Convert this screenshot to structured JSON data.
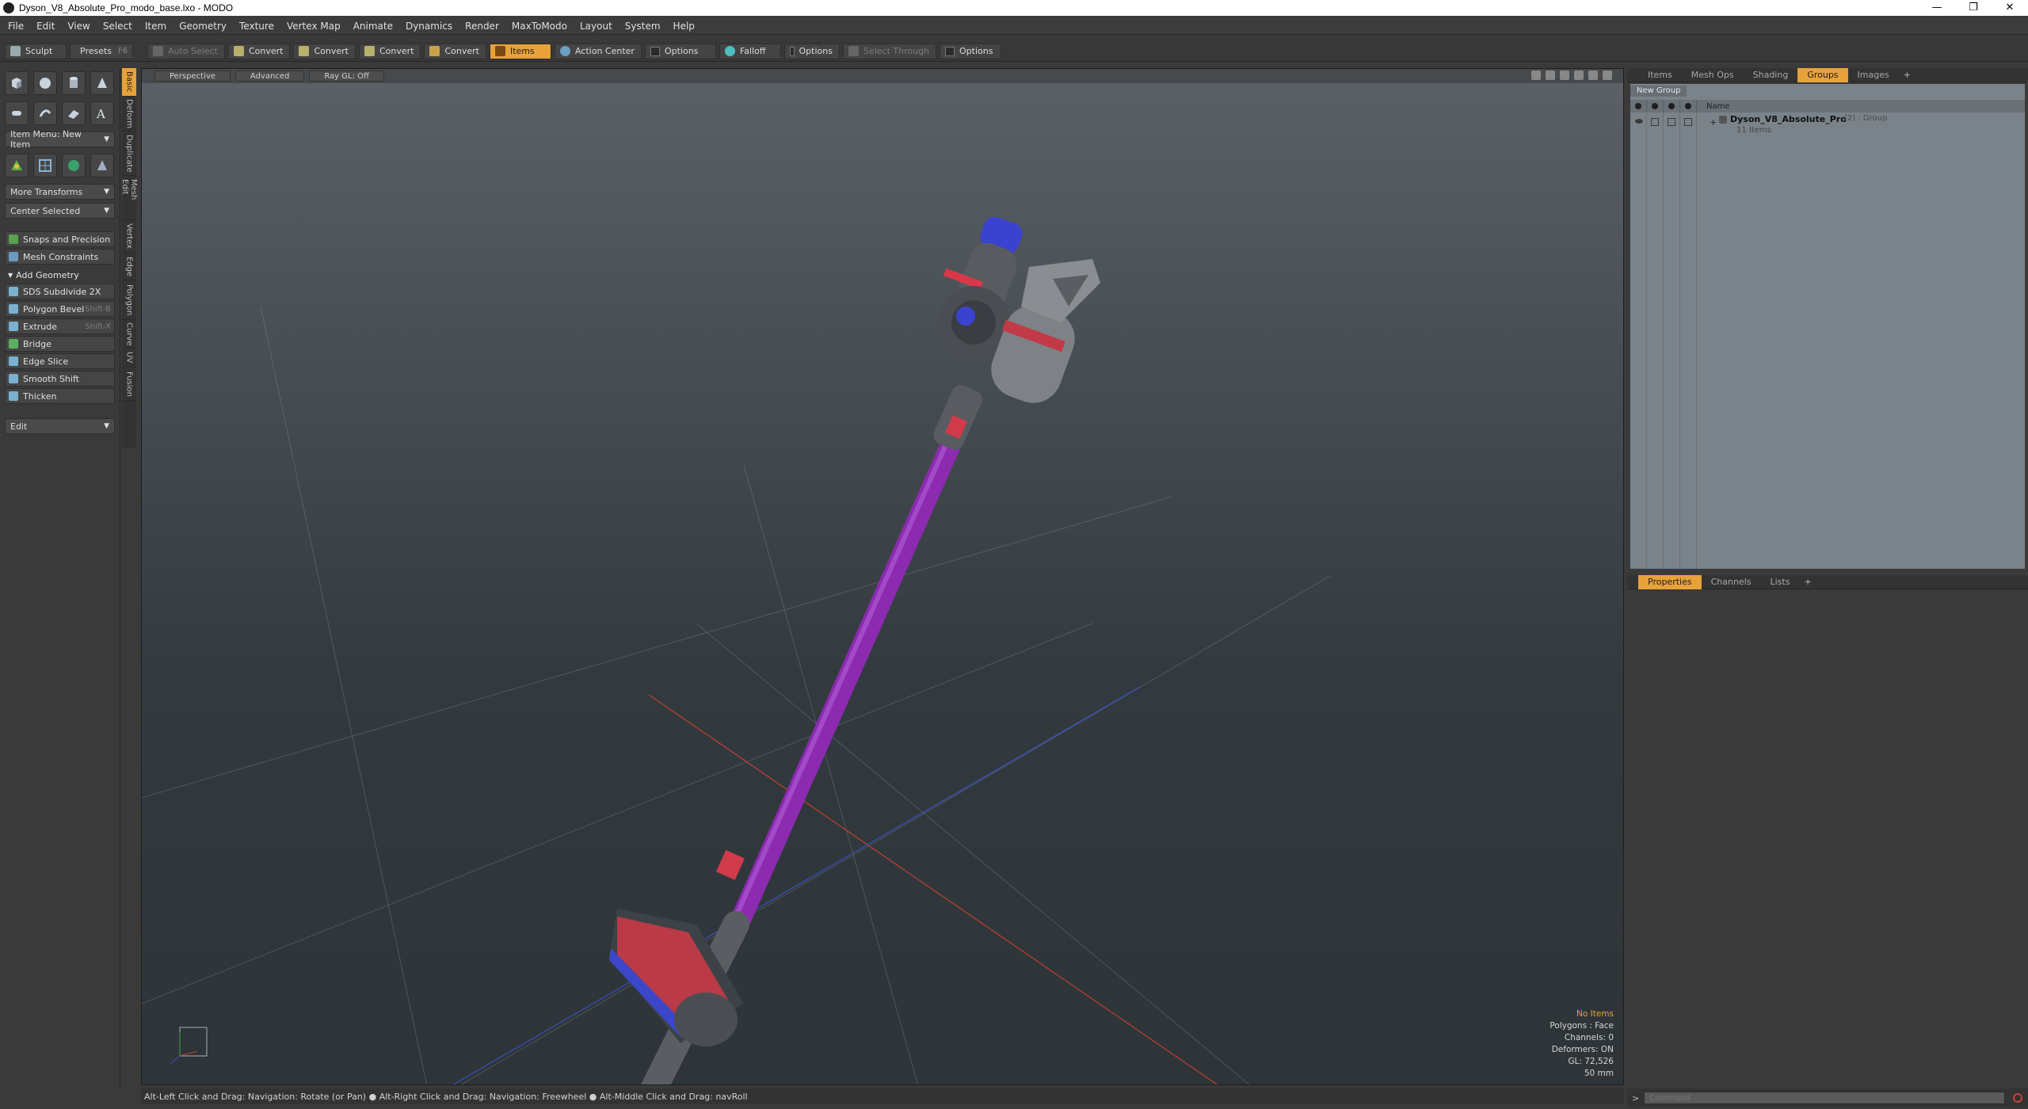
{
  "window": {
    "title": "Dyson_V8_Absolute_Pro_modo_base.lxo - MODO",
    "controls": [
      "—",
      "❐",
      "✕"
    ]
  },
  "menubar": [
    "File",
    "Edit",
    "View",
    "Select",
    "Item",
    "Geometry",
    "Texture",
    "Vertex Map",
    "Animate",
    "Dynamics",
    "Render",
    "MaxToModo",
    "Layout",
    "System",
    "Help"
  ],
  "toolbar": {
    "sculpt": "Sculpt",
    "presets": "Presets",
    "presets_shortcut": "F6",
    "auto_select": "Auto Select",
    "convert1": "Convert",
    "convert2": "Convert",
    "convert3": "Convert",
    "convert4": "Convert",
    "items": "Items",
    "action_center": "Action Center",
    "options1": "Options",
    "falloff": "Falloff",
    "options2": "Options",
    "select_through": "Select Through",
    "options3": "Options"
  },
  "leftpanel": {
    "item_menu": "Item Menu: New Item",
    "more_transforms": "More Transforms",
    "center_selected": "Center Selected",
    "snaps": "Snaps and Precision",
    "mesh_constraints": "Mesh Constraints",
    "add_geometry": "Add Geometry",
    "sds": "SDS Subdivide 2X",
    "polygon_bevel": "Polygon Bevel",
    "polygon_bevel_sc": "Shift-B",
    "extrude": "Extrude",
    "extrude_sc": "Shift-X",
    "bridge": "Bridge",
    "edge_slice": "Edge Slice",
    "smooth_shift": "Smooth Shift",
    "thicken": "Thicken",
    "edit": "Edit"
  },
  "vtabs": [
    "Basic",
    "Deform",
    "Duplicate",
    "Mesh Edit",
    "Vertex",
    "Edge",
    "Polygon",
    "Curve",
    "UV",
    "Fusion"
  ],
  "viewport": {
    "tabs": [
      "Perspective",
      "Advanced",
      "Ray GL: Off"
    ],
    "info": {
      "selection": "No Items",
      "polygons": "Polygons : Face",
      "channels": "Channels: 0",
      "deformers": "Deformers: ON",
      "gl": "GL: 72,526",
      "focal": "50 mm"
    }
  },
  "statusbar": "Alt-Left Click and Drag: Navigation: Rotate (or Pan) ● Alt-Right Click and Drag: Navigation: Freewheel ● Alt-Middle Click and Drag: navRoll",
  "rightpanel": {
    "tabs": [
      "Items",
      "Mesh Ops",
      "Shading",
      "Groups",
      "Images"
    ],
    "new_group": "New Group",
    "name_col": "Name",
    "group_name": "Dyson_V8_Absolute_Pro",
    "group_sub": "(2) : Group",
    "group_count": "11 Items",
    "props_tabs": [
      "Properties",
      "Channels",
      "Lists"
    ]
  },
  "command": {
    "placeholder": "Command"
  },
  "colors": {
    "accent": "#e8a23a",
    "tube": "#8c2ab0",
    "blue_cap": "#3a3fd0",
    "red_accent": "#e03a48"
  }
}
